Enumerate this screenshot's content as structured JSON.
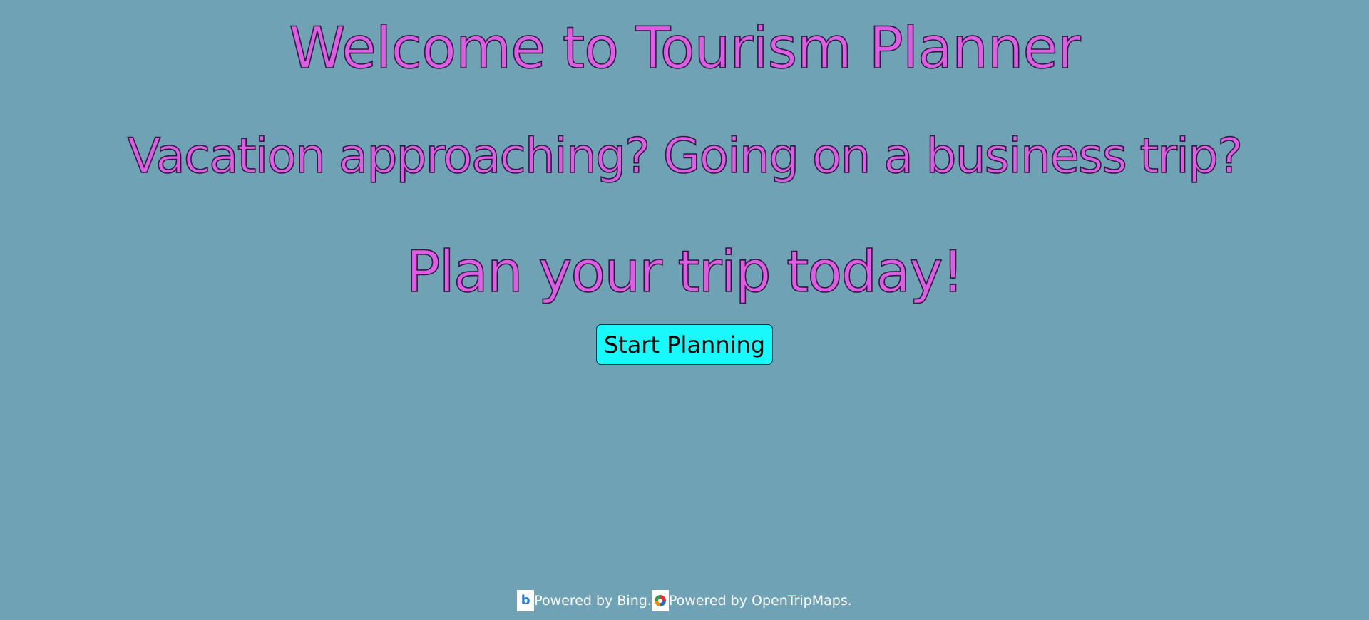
{
  "hero": {
    "title": "Welcome to Tourism Planner",
    "subtitle": "Vacation approaching? Going on a business trip?",
    "cta_heading": "Plan your trip today!"
  },
  "actions": {
    "start_label": "Start Planning"
  },
  "footer": {
    "bing_icon": "bing-logo",
    "bing_text": "Powered by Bing",
    "separator": ".",
    "otm_icon": "opentripmap-logo",
    "otm_text": "Powered by OpenTripMaps."
  },
  "colors": {
    "background": "#6fa2b5",
    "heading_fill": "#e05ce6",
    "button_bg": "#19f9fb",
    "footer_text": "#ffffff"
  }
}
